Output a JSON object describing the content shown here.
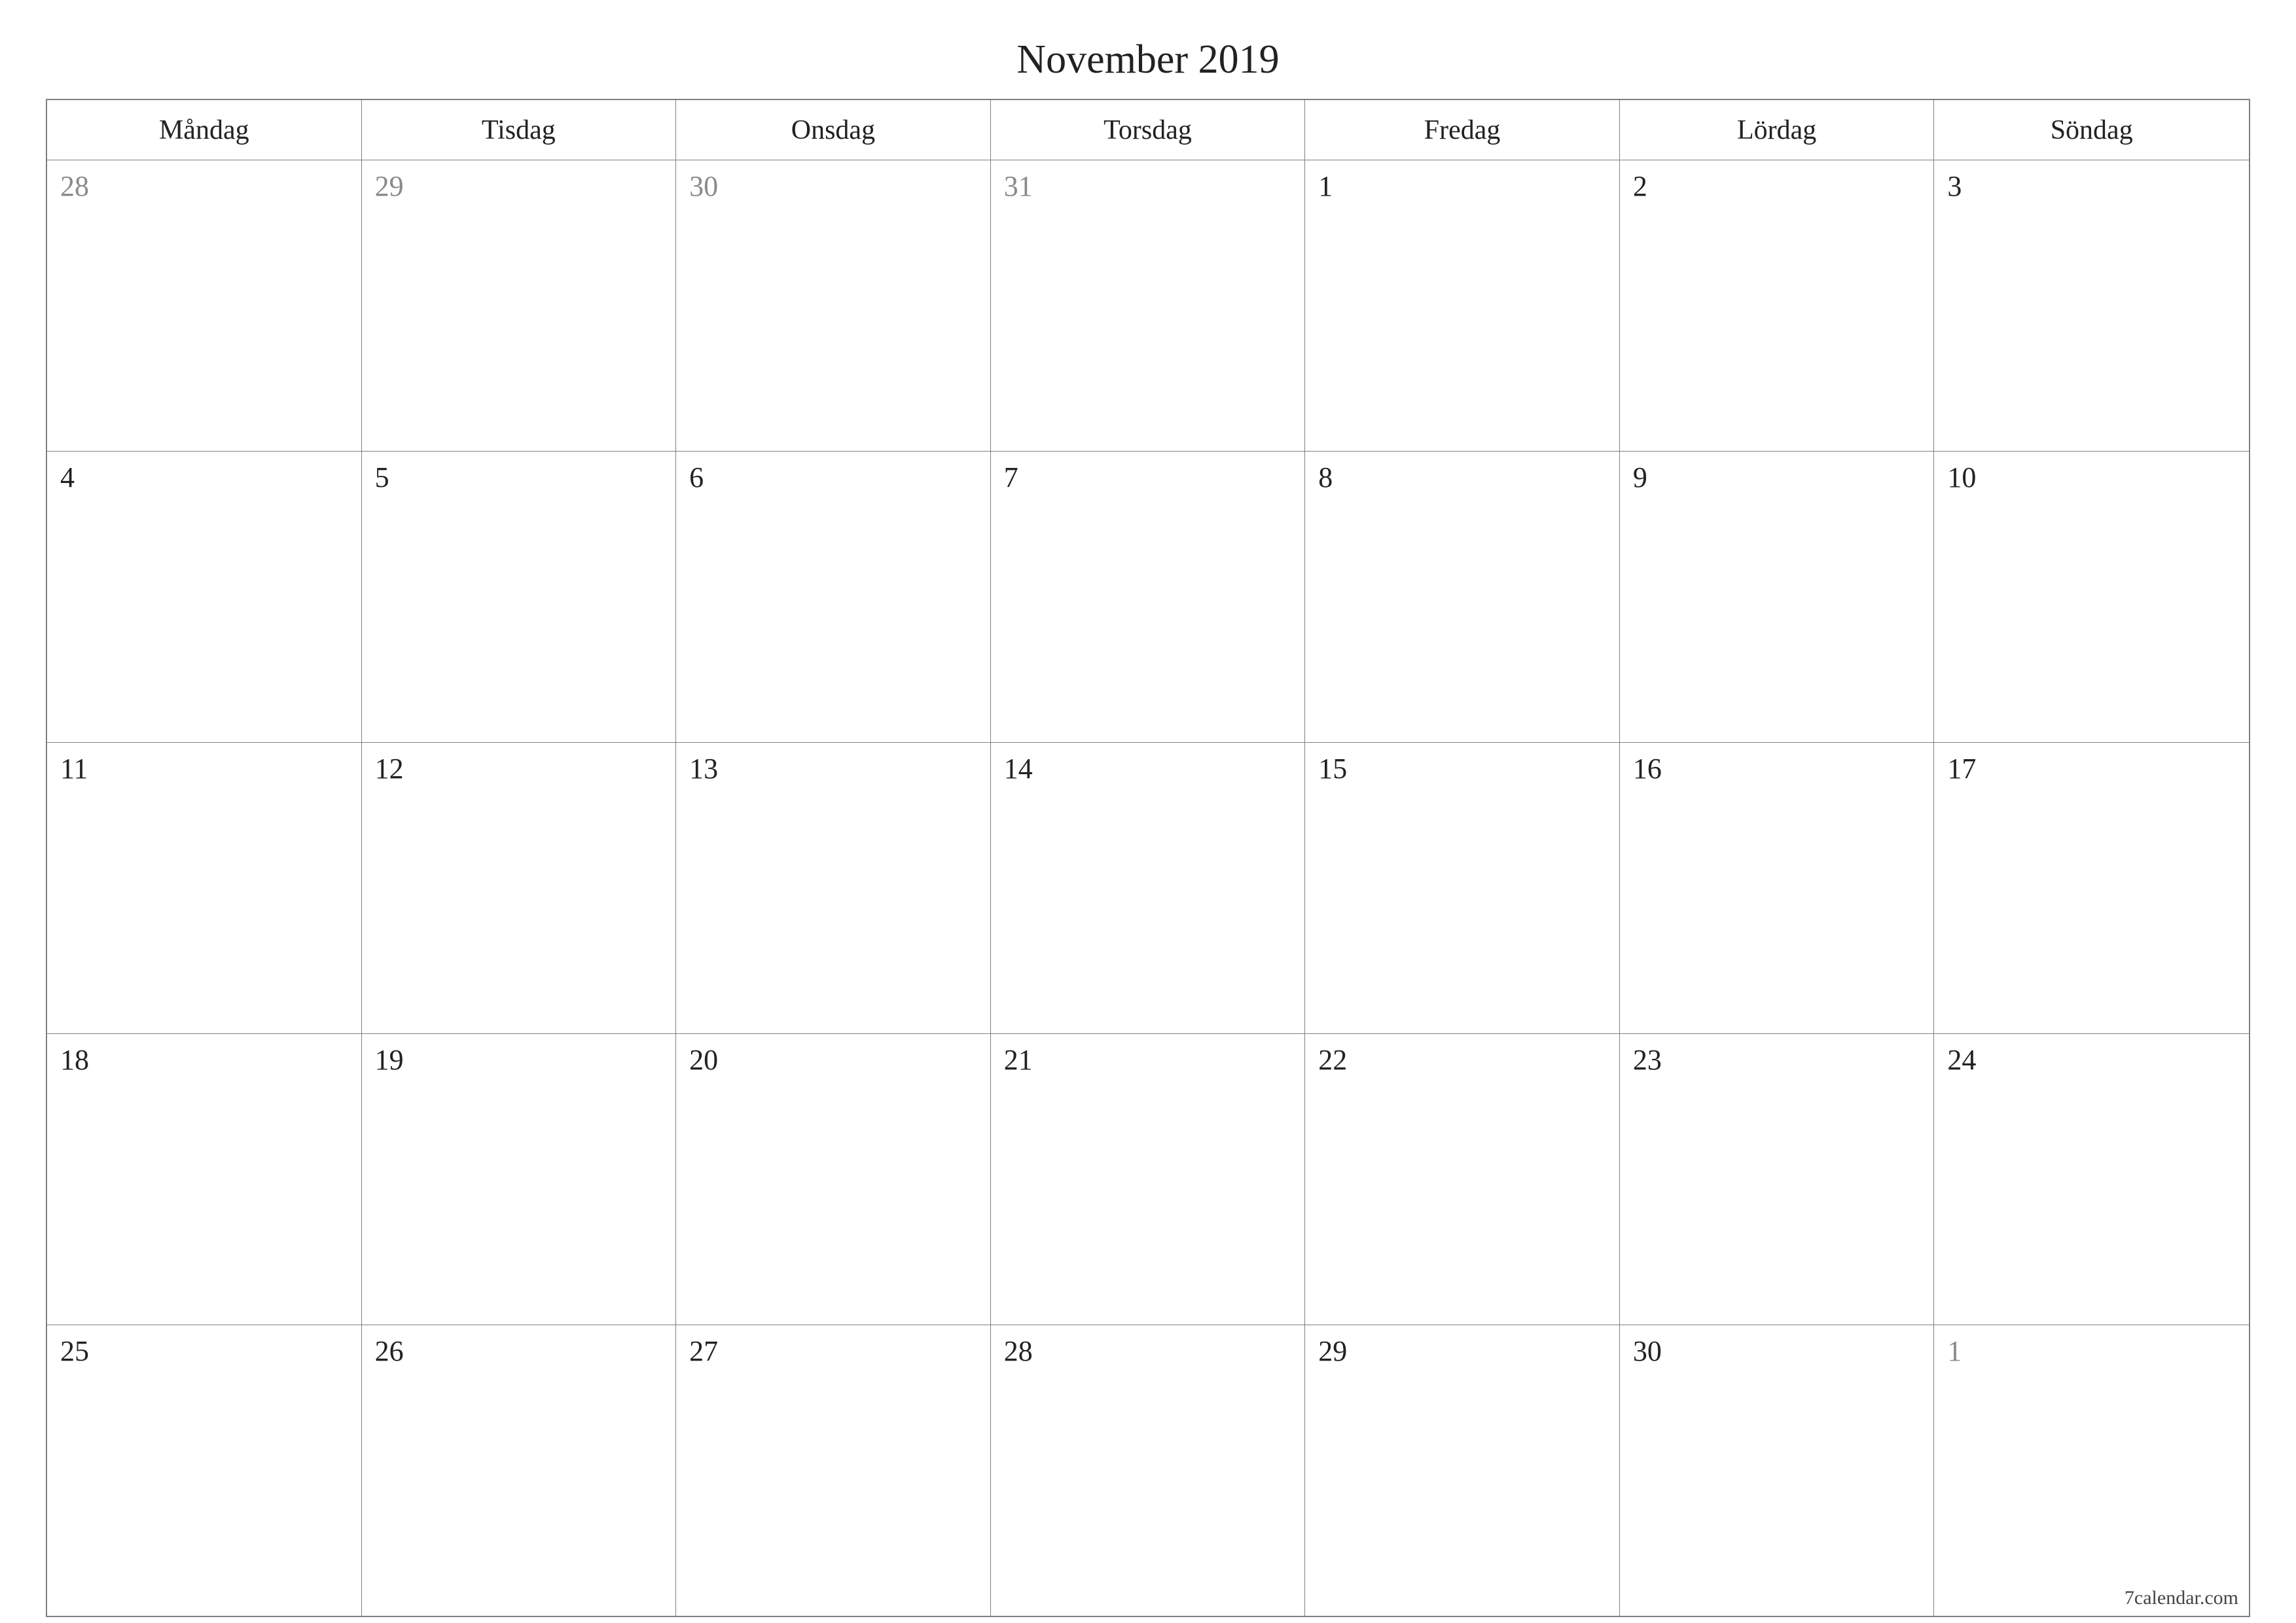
{
  "title": "November 2019",
  "footer": "7calendar.com",
  "weekdays": [
    "Måndag",
    "Tisdag",
    "Onsdag",
    "Torsdag",
    "Fredag",
    "Lördag",
    "Söndag"
  ],
  "weeks": [
    [
      {
        "n": "28",
        "other": true
      },
      {
        "n": "29",
        "other": true
      },
      {
        "n": "30",
        "other": true
      },
      {
        "n": "31",
        "other": true
      },
      {
        "n": "1",
        "other": false
      },
      {
        "n": "2",
        "other": false
      },
      {
        "n": "3",
        "other": false
      }
    ],
    [
      {
        "n": "4",
        "other": false
      },
      {
        "n": "5",
        "other": false
      },
      {
        "n": "6",
        "other": false
      },
      {
        "n": "7",
        "other": false
      },
      {
        "n": "8",
        "other": false
      },
      {
        "n": "9",
        "other": false
      },
      {
        "n": "10",
        "other": false
      }
    ],
    [
      {
        "n": "11",
        "other": false
      },
      {
        "n": "12",
        "other": false
      },
      {
        "n": "13",
        "other": false
      },
      {
        "n": "14",
        "other": false
      },
      {
        "n": "15",
        "other": false
      },
      {
        "n": "16",
        "other": false
      },
      {
        "n": "17",
        "other": false
      }
    ],
    [
      {
        "n": "18",
        "other": false
      },
      {
        "n": "19",
        "other": false
      },
      {
        "n": "20",
        "other": false
      },
      {
        "n": "21",
        "other": false
      },
      {
        "n": "22",
        "other": false
      },
      {
        "n": "23",
        "other": false
      },
      {
        "n": "24",
        "other": false
      }
    ],
    [
      {
        "n": "25",
        "other": false
      },
      {
        "n": "26",
        "other": false
      },
      {
        "n": "27",
        "other": false
      },
      {
        "n": "28",
        "other": false
      },
      {
        "n": "29",
        "other": false
      },
      {
        "n": "30",
        "other": false
      },
      {
        "n": "1",
        "other": true
      }
    ]
  ]
}
